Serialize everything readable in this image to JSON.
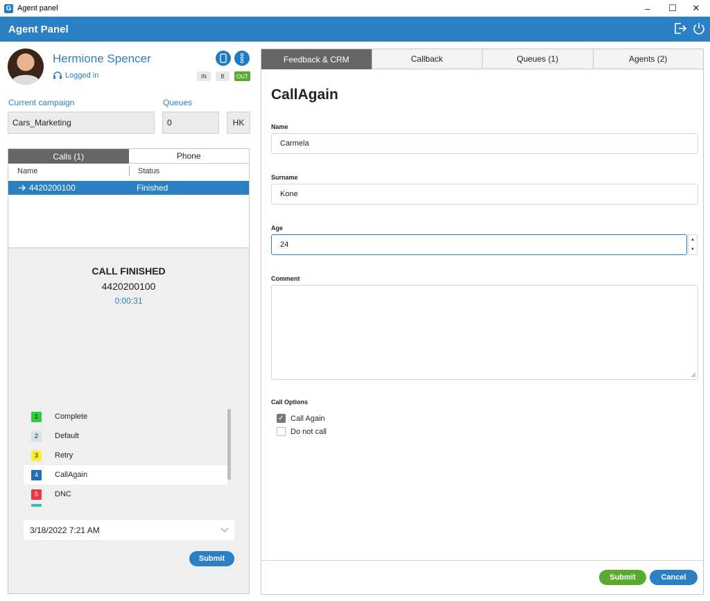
{
  "window": {
    "title": "Agent panel",
    "minimize": "–",
    "maximize": "☐",
    "close": "✕",
    "logo_letter": "G"
  },
  "header": {
    "title": "Agent Panel"
  },
  "agent": {
    "name": "Hermione Spencer",
    "status": "Logged in",
    "modes": [
      "IN",
      "B",
      "OUT"
    ]
  },
  "campaign": {
    "label": "Current campaign",
    "value": "Cars_Marketing"
  },
  "queues": {
    "label": "Queues",
    "value": "0",
    "hk": "HK"
  },
  "calls": {
    "tabs": [
      "Calls (1)",
      "Phone"
    ],
    "columns": [
      "Name",
      "Status"
    ],
    "rows": [
      {
        "name": "4420200100",
        "status": "Finished"
      }
    ]
  },
  "call_info": {
    "state": "CALL FINISHED",
    "number": "4420200100",
    "duration": "0:00:31"
  },
  "dispositions": [
    {
      "num": "1",
      "label": "Complete",
      "color": "#2ecc40"
    },
    {
      "num": "2",
      "label": "Default",
      "color": "#d5e2e8"
    },
    {
      "num": "3",
      "label": "Retry",
      "color": "#f7f035"
    },
    {
      "num": "4",
      "label": "CallAgain",
      "color": "#1f6fb8"
    },
    {
      "num": "5",
      "label": "DNC",
      "color": "#e63946"
    }
  ],
  "datetime": {
    "value": "3/18/2022 7:21 AM"
  },
  "left_submit": "Submit",
  "right_tabs": [
    "Feedback & CRM",
    "Callback",
    "Queues (1)",
    "Agents (2)"
  ],
  "form": {
    "title": "CallAgain",
    "name_label": "Name",
    "name_value": "Carmela",
    "surname_label": "Surname",
    "surname_value": "Kone",
    "age_label": "Age",
    "age_value": "24",
    "comment_label": "Comment",
    "options_label": "Call Options",
    "opt_call_again": "Call Again",
    "opt_do_not_call": "Do not call"
  },
  "footer": {
    "submit": "Submit",
    "cancel": "Cancel"
  }
}
